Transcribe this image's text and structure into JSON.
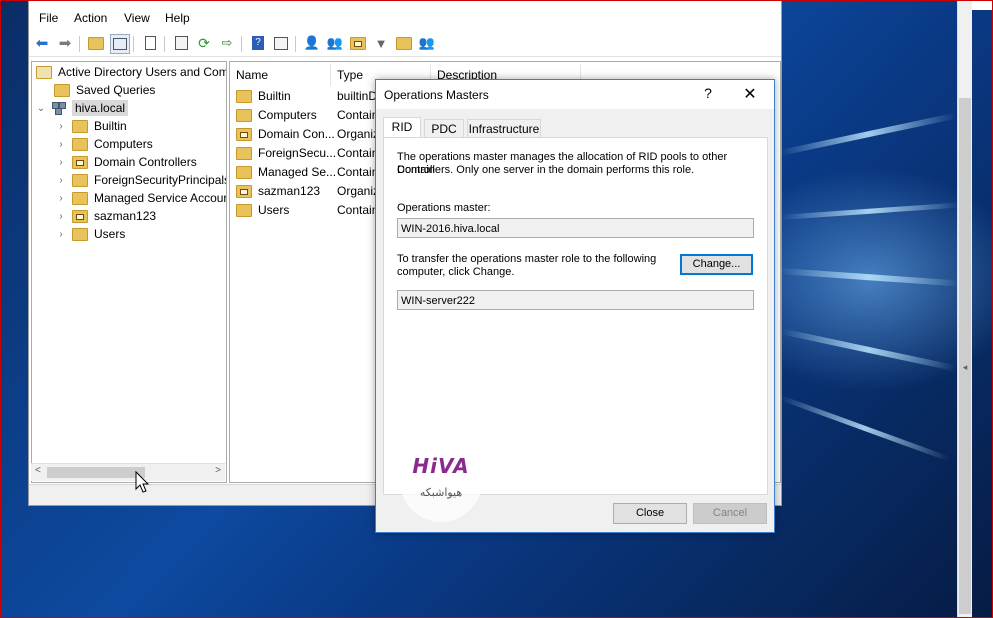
{
  "menu": [
    "File",
    "Action",
    "View",
    "Help"
  ],
  "toolbar_icons": [
    "back-arrow-icon",
    "forward-arrow-icon",
    "up-folder-icon",
    "show-hide-console-tree-icon",
    "copy-icon",
    "properties-icon",
    "refresh-icon",
    "export-list-icon",
    "help-icon",
    "console-icon",
    "new-user-icon",
    "new-group-icon",
    "new-ou-icon",
    "filter-icon",
    "find-icon",
    "add-to-group-icon"
  ],
  "tree": {
    "root": "Active Directory Users and Com",
    "saved_queries": "Saved Queries",
    "domain": "hiva.local",
    "children": [
      "Builtin",
      "Computers",
      "Domain Controllers",
      "ForeignSecurityPrincipals",
      "Managed Service Accour",
      "sazman123",
      "Users"
    ]
  },
  "list": {
    "headers": {
      "name": "Name",
      "type": "Type",
      "description": "Description"
    },
    "rows": [
      {
        "name": "Builtin",
        "type": "builtinD"
      },
      {
        "name": "Computers",
        "type": "Contain"
      },
      {
        "name": "Domain Con...",
        "type": "Organiz"
      },
      {
        "name": "ForeignSecu...",
        "type": "Contain"
      },
      {
        "name": "Managed Se...",
        "type": "Contain"
      },
      {
        "name": "sazman123",
        "type": "Organiz"
      },
      {
        "name": "Users",
        "type": "Contain"
      }
    ]
  },
  "dialog": {
    "title": "Operations Masters",
    "help": "?",
    "close_glyph": "✕",
    "tabs": [
      "RID",
      "PDC",
      "Infrastructure"
    ],
    "active_tab": "RID",
    "description_line1": "The operations master manages the allocation of RID pools to other Domain",
    "description_line2": "Controllers. Only one server in the domain performs this role.",
    "ops_master_label": "Operations master:",
    "ops_master_value": "WIN-2016.hiva.local",
    "transfer_line1": "To transfer the operations master role to the following",
    "transfer_line2": "computer, click Change.",
    "change_button": "Change...",
    "target_value": "WIN-server222",
    "close_button": "Close",
    "cancel_button": "Cancel"
  },
  "watermark": {
    "brand": "HiVA",
    "subtitle": "هیواشبکه"
  },
  "colors": {
    "accent": "#0078d7",
    "folder": "#e8c25a",
    "frame": "#cc0000",
    "watermark": "#8b2a8e"
  }
}
